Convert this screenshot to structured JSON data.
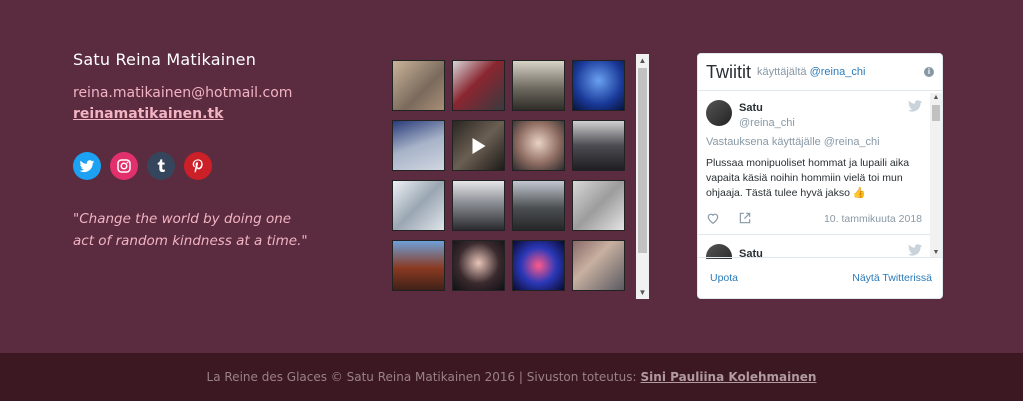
{
  "contact": {
    "name": "Satu Reina Matikainen",
    "email": "reina.matikainen@hotmail.com",
    "website": "reinamatikainen.tk",
    "quote": "\"Change the world by doing one act of random kindness at a time.\""
  },
  "socials": [
    {
      "icon": "twitter-icon",
      "color": "#1da1f2"
    },
    {
      "icon": "instagram-icon",
      "color": "#e1306c"
    },
    {
      "icon": "tumblr-icon",
      "color": "#35465c"
    },
    {
      "icon": "pinterest-icon",
      "color": "#cb2027"
    }
  ],
  "gallery": {
    "thumbs": [
      {
        "bg": "linear-gradient(135deg,#c9b39a,#7a6a5c 60%,#a88f76)"
      },
      {
        "bg": "linear-gradient(135deg,#d5d5d8,#8a2630 45%,#3a3a40)"
      },
      {
        "bg": "linear-gradient(180deg,#d9d4c8,#6e6a60 55%,#2f2c28)"
      },
      {
        "bg": "radial-gradient(circle at 50% 40%,#6aa0f0,#1a3a9a 60%,#08123a)"
      },
      {
        "bg": "linear-gradient(160deg,#2a3c7a,#a7b3c8 50%,#d0d6e0)"
      },
      {
        "bg": "linear-gradient(135deg,#2a2622,#6b5f53 50%,#1d1a17)",
        "video": true
      },
      {
        "bg": "radial-gradient(circle at 50% 45%,#e9d2c4,#8f6d62 55%,#2c2b2e)"
      },
      {
        "bg": "linear-gradient(180deg,#d0d0d2,#4c4c52 50%,#1e1e22)"
      },
      {
        "bg": "linear-gradient(135deg,#eef2f6,#9aa6b2 50%,#dfe4ea)"
      },
      {
        "bg": "linear-gradient(180deg,#e6e6e8,#8a8d94 45%,#2a2a2e)"
      },
      {
        "bg": "linear-gradient(180deg,#c3c8d0,#4b4f52 55%,#262628)"
      },
      {
        "bg": "linear-gradient(135deg,#d8d8d8,#9c9c9c 50%,#e4e4e4)"
      },
      {
        "bg": "linear-gradient(180deg,#6ea0d8,#8a3a22 55%,#402218)"
      },
      {
        "bg": "radial-gradient(circle at 50% 45%,#e8c4b8,#3a2a2e 55%,#101014)"
      },
      {
        "bg": "radial-gradient(circle at 50% 50%,#ff5a8a,#2a38b8 50%,#0a0a30)"
      },
      {
        "bg": "linear-gradient(135deg,#8a6a6a,#c8b0a0 40%,#5a5a62)"
      }
    ]
  },
  "twitter": {
    "title": "Twiitit",
    "by_prefix": "käyttäjältä",
    "by_handle": "@reina_chi",
    "tweets": [
      {
        "name": "Satu",
        "handle": "@reina_chi",
        "reply": "Vastauksena käyttäjälle @reina_chi",
        "text": "Plussaa monipuoliset hommat ja lupaili aika vapaita käsiä noihin hommiin vielä toi mun ohjaaja. Tästä tulee hyvä jakso 👍",
        "date": "10. tammikuuta 2018"
      },
      {
        "name": "Satu"
      }
    ],
    "embed_label": "Upota",
    "view_label": "Näytä Twitterissä"
  },
  "footer": {
    "text": "La Reine des Glaces © Satu Reina Matikainen 2016 | Sivuston toteutus:",
    "author": "Sini Pauliina Kolehmainen"
  }
}
